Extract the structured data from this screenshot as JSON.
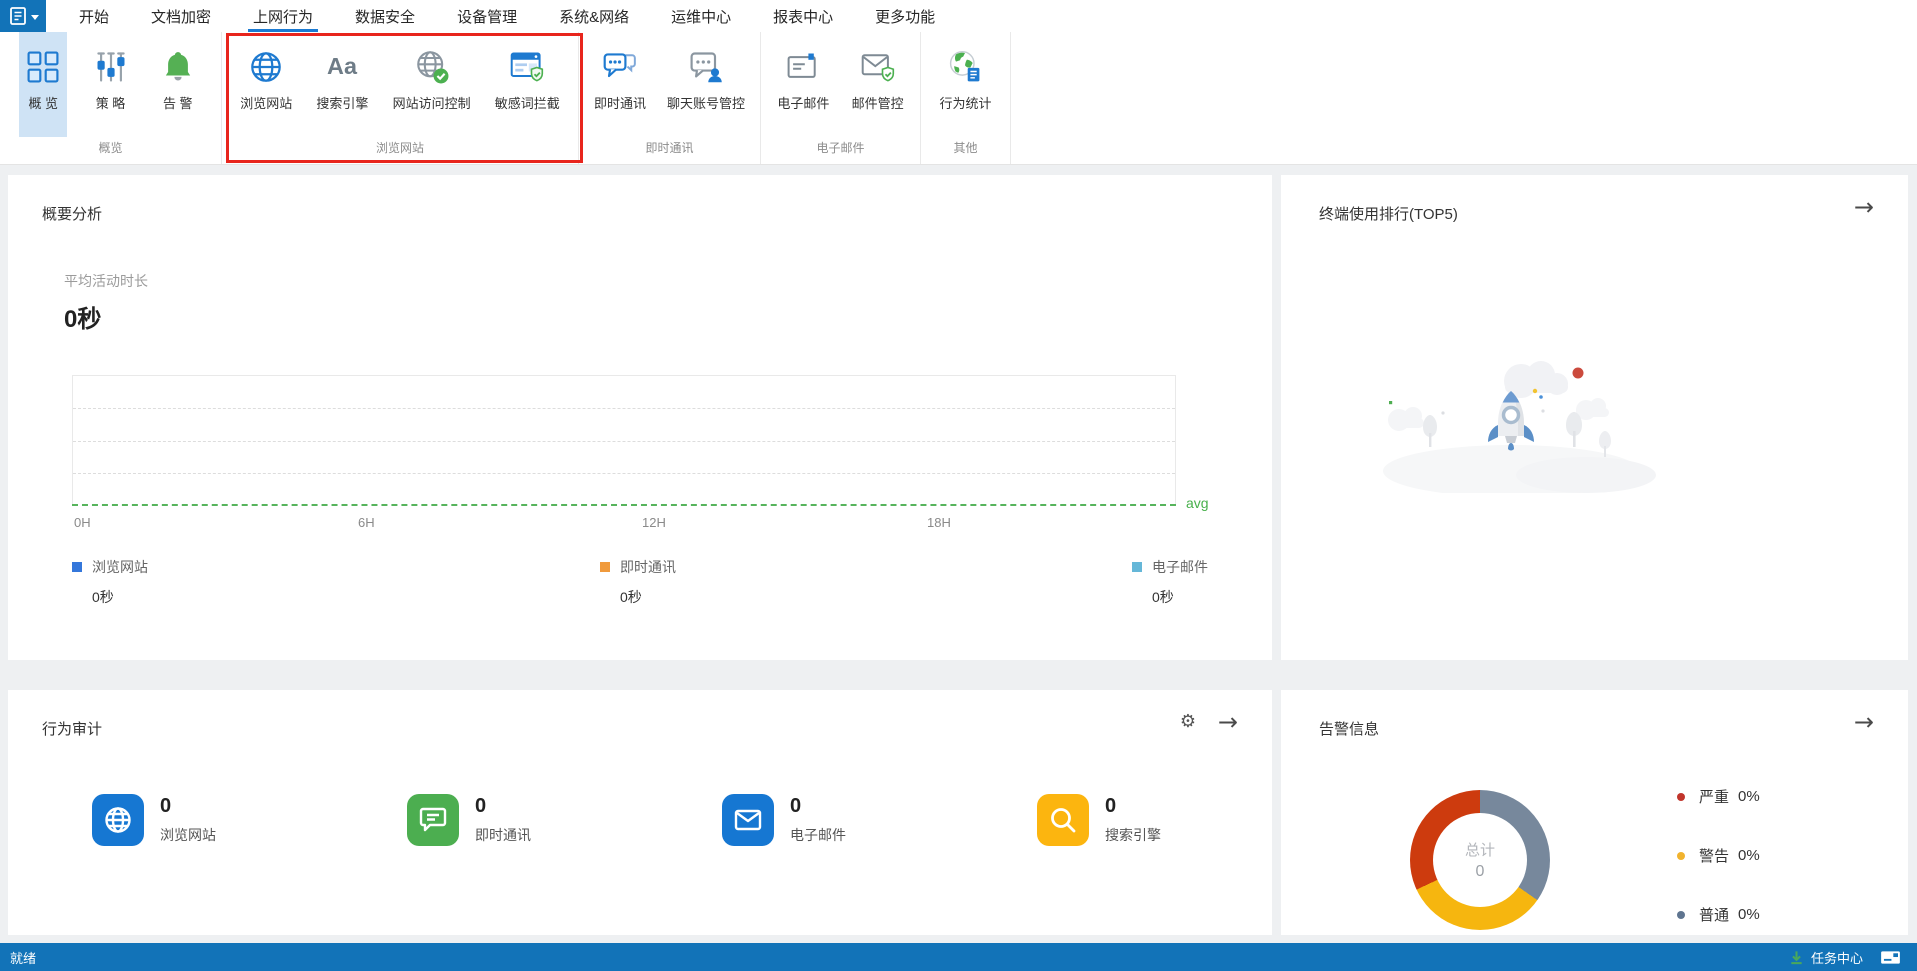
{
  "menubar": {
    "items": [
      {
        "label": "开始"
      },
      {
        "label": "文档加密"
      },
      {
        "label": "上网行为",
        "active": true
      },
      {
        "label": "数据安全"
      },
      {
        "label": "设备管理"
      },
      {
        "label": "系统&网络"
      },
      {
        "label": "运维中心"
      },
      {
        "label": "报表中心"
      },
      {
        "label": "更多功能"
      }
    ]
  },
  "ribbon": {
    "groups": [
      {
        "label": "概览",
        "items": [
          {
            "label": "概 览",
            "icon": "overview-grid-icon",
            "selected": true
          },
          {
            "label": "策 略",
            "icon": "policy-sliders-icon"
          },
          {
            "label": "告 警",
            "icon": "alert-bell-icon"
          }
        ]
      },
      {
        "label": "浏览网站",
        "annotation": "red highlight box around this group",
        "items": [
          {
            "label": "浏览网站",
            "icon": "browse-website-globe-icon"
          },
          {
            "label": "搜索引擎",
            "icon": "search-engine-aa-icon"
          },
          {
            "label": "网站访问控制",
            "icon": "website-access-control-icon"
          },
          {
            "label": "敏感词拦截",
            "icon": "sensitive-word-block-icon"
          }
        ]
      },
      {
        "label": "即时通讯",
        "items": [
          {
            "label": "即时通讯",
            "icon": "instant-message-icon"
          },
          {
            "label": "聊天账号管控",
            "icon": "chat-account-control-icon"
          }
        ]
      },
      {
        "label": "电子邮件",
        "items": [
          {
            "label": "电子邮件",
            "icon": "email-icon"
          },
          {
            "label": "邮件管控",
            "icon": "email-control-icon"
          }
        ]
      },
      {
        "label": "其他",
        "items": [
          {
            "label": "行为统计",
            "icon": "behavior-stats-icon"
          }
        ]
      }
    ],
    "selected_bg": "#cfe3f5",
    "annotation_color": "#e8251d"
  },
  "summary_card": {
    "title": "概要分析",
    "metric_label": "平均活动时长",
    "metric_value": "0秒"
  },
  "chart_data": {
    "type": "line",
    "title": "平均活动时长",
    "x_ticks": [
      "0H",
      "6H",
      "12H",
      "18H"
    ],
    "x_range_hours": [
      0,
      24
    ],
    "ylim": [
      0,
      1
    ],
    "grid": "horizontal-dashed",
    "series": [
      {
        "name": "浏览网站",
        "color": "#3477db",
        "total": "0秒",
        "values": [
          0,
          0,
          0,
          0,
          0
        ]
      },
      {
        "name": "即时通讯",
        "color": "#f09a3c",
        "total": "0秒",
        "values": [
          0,
          0,
          0,
          0,
          0
        ]
      },
      {
        "name": "电子邮件",
        "color": "#65b7d8",
        "total": "0秒",
        "values": [
          0,
          0,
          0,
          0,
          0
        ]
      }
    ],
    "avg_line": {
      "label": "avg",
      "value": 0,
      "color": "#47b04b"
    },
    "legend_position": "bottom"
  },
  "top5_card": {
    "title": "终端使用排行(TOP5)",
    "empty_state": "rocket illustration, no data"
  },
  "audit_card": {
    "title": "行为审计",
    "stats": [
      {
        "value": "0",
        "label": "浏览网站",
        "icon": "globe-stat-icon",
        "color": "#1677d2"
      },
      {
        "value": "0",
        "label": "即时通讯",
        "icon": "chat-stat-icon",
        "color": "#4cae50"
      },
      {
        "value": "0",
        "label": "电子邮件",
        "icon": "mail-stat-icon",
        "color": "#1677d2"
      },
      {
        "value": "0",
        "label": "搜索引擎",
        "icon": "search-stat-icon",
        "color": "#fcb50f"
      }
    ]
  },
  "alert_card": {
    "title": "告警信息",
    "donut": {
      "center_label": "总计",
      "center_value": "0",
      "slices": [
        {
          "name": "普通",
          "color": "#77889c",
          "sweep_deg": 125
        },
        {
          "name": "警告",
          "color": "#f6b60f",
          "sweep_deg": 120
        },
        {
          "name": "严重",
          "color": "#cd3b0e",
          "sweep_deg": 115
        }
      ]
    },
    "legend": [
      {
        "name": "严重",
        "value": "0%",
        "color": "#c1352c"
      },
      {
        "name": "警告",
        "value": "0%",
        "color": "#f1b32e"
      },
      {
        "name": "普通",
        "value": "0%",
        "color": "#5f7590"
      }
    ]
  },
  "statusbar": {
    "left": "就绪",
    "task_center": "任务中心",
    "bg_color": "#1273b8"
  }
}
